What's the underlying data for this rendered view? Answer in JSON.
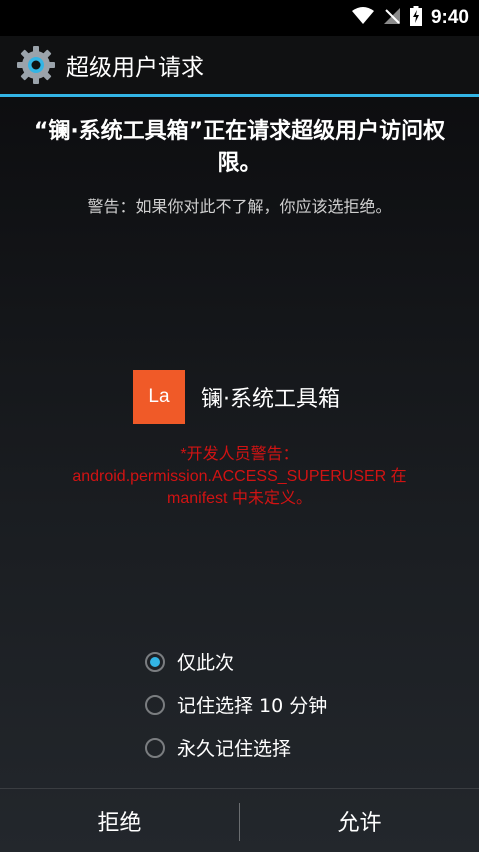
{
  "status_bar": {
    "time": "9:40",
    "icons": [
      "wifi-icon",
      "signal-no-sim-icon",
      "battery-charging-icon"
    ]
  },
  "action_bar": {
    "icon": "gear-icon",
    "title": "超级用户请求"
  },
  "dialog": {
    "request_text": "“镧·系统工具箱”正在请求超级用户访问权限。",
    "warning_text": "警告：如果你对此不了解，你应该选拒绝。",
    "app": {
      "badge": "La",
      "badge_color": "#f05a28",
      "name": "镧·系统工具箱"
    },
    "dev_warning_line1": "*开发人员警告：",
    "dev_warning_line2": "android.permission.ACCESS_SUPERUSER 在",
    "dev_warning_line3": "manifest 中未定义。",
    "options": [
      {
        "label": "仅此次",
        "selected": true
      },
      {
        "label": "记住选择 10 分钟",
        "selected": false
      },
      {
        "label": "永久记住选择",
        "selected": false
      }
    ]
  },
  "buttons": {
    "deny": "拒绝",
    "allow": "允许"
  },
  "colors": {
    "accent": "#33b5e5",
    "warning": "#d11313"
  }
}
